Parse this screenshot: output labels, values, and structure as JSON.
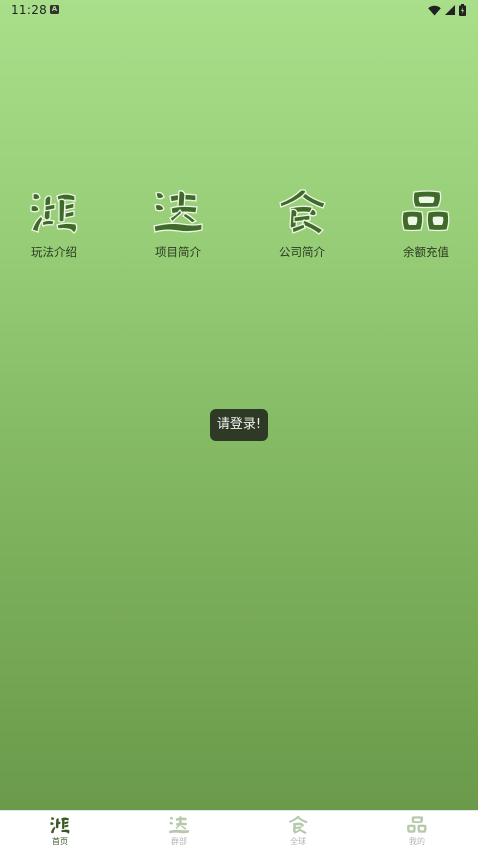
{
  "status_bar": {
    "time": "11:28",
    "notification_icon": "A"
  },
  "features": [
    {
      "label": "玩法介绍",
      "icon_glyph": "鸿"
    },
    {
      "label": "项目简介",
      "icon_glyph": "达"
    },
    {
      "label": "公司简介",
      "icon_glyph": "食"
    },
    {
      "label": "余额充值",
      "icon_glyph": "品"
    }
  ],
  "toast": {
    "message": "请登录!"
  },
  "bottom_nav": [
    {
      "label": "首页",
      "icon_glyph": "鸿",
      "active": true
    },
    {
      "label": "群部",
      "icon_glyph": "达",
      "active": false
    },
    {
      "label": "全球",
      "icon_glyph": "食",
      "active": false
    },
    {
      "label": "我的",
      "icon_glyph": "品",
      "active": false
    }
  ],
  "colors": {
    "gradient_top": "#a9df8a",
    "gradient_bottom": "#6a9a4a",
    "brand_dark_green": "#3a5a25",
    "toast_background": "#2e3a25"
  }
}
